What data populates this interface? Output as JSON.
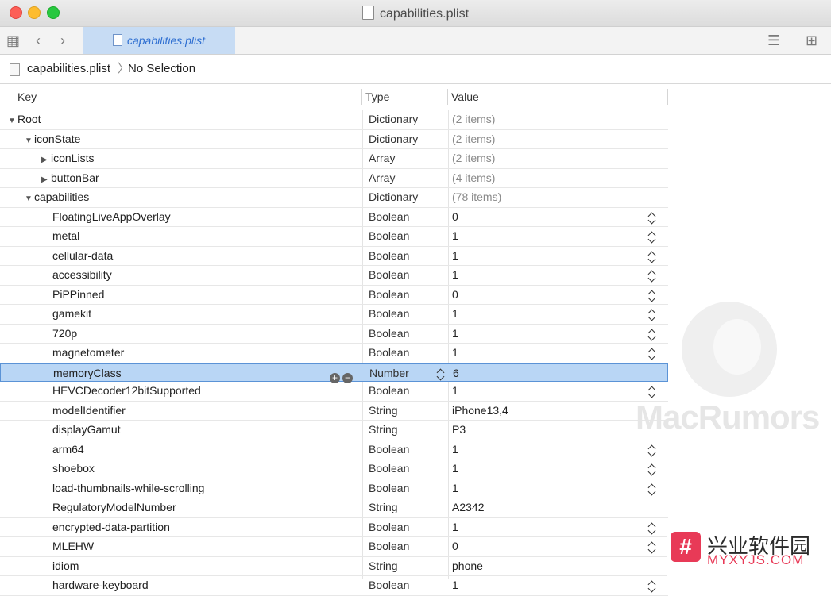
{
  "window": {
    "title": "capabilities.plist"
  },
  "toolbar": {
    "tab_label": "capabilities.plist"
  },
  "jumpbar": {
    "file": "capabilities.plist",
    "separator": "〉",
    "selection": "No Selection"
  },
  "columns": {
    "key": "Key",
    "type": "Type",
    "value": "Value"
  },
  "rows": [
    {
      "key": "Root",
      "type": "Dictionary",
      "value": "(2 items)"
    },
    {
      "key": "iconState",
      "type": "Dictionary",
      "value": "(2 items)"
    },
    {
      "key": "iconLists",
      "type": "Array",
      "value": "(2 items)"
    },
    {
      "key": "buttonBar",
      "type": "Array",
      "value": "(4 items)"
    },
    {
      "key": "capabilities",
      "type": "Dictionary",
      "value": "(78 items)"
    },
    {
      "key": "FloatingLiveAppOverlay",
      "type": "Boolean",
      "value": "0"
    },
    {
      "key": "metal",
      "type": "Boolean",
      "value": "1"
    },
    {
      "key": "cellular-data",
      "type": "Boolean",
      "value": "1"
    },
    {
      "key": "accessibility",
      "type": "Boolean",
      "value": "1"
    },
    {
      "key": "PiPPinned",
      "type": "Boolean",
      "value": "0"
    },
    {
      "key": "gamekit",
      "type": "Boolean",
      "value": "1"
    },
    {
      "key": "720p",
      "type": "Boolean",
      "value": "1"
    },
    {
      "key": "magnetometer",
      "type": "Boolean",
      "value": "1"
    },
    {
      "key": "memoryClass",
      "type": "Number",
      "value": "6"
    },
    {
      "key": "HEVCDecoder12bitSupported",
      "type": "Boolean",
      "value": "1"
    },
    {
      "key": "modelIdentifier",
      "type": "String",
      "value": "iPhone13,4"
    },
    {
      "key": "displayGamut",
      "type": "String",
      "value": "P3"
    },
    {
      "key": "arm64",
      "type": "Boolean",
      "value": "1"
    },
    {
      "key": "shoebox",
      "type": "Boolean",
      "value": "1"
    },
    {
      "key": "load-thumbnails-while-scrolling",
      "type": "Boolean",
      "value": "1"
    },
    {
      "key": "RegulatoryModelNumber",
      "type": "String",
      "value": "A2342"
    },
    {
      "key": "encrypted-data-partition",
      "type": "Boolean",
      "value": "1"
    },
    {
      "key": "MLEHW",
      "type": "Boolean",
      "value": "0"
    },
    {
      "key": "idiom",
      "type": "String",
      "value": "phone"
    },
    {
      "key": "hardware-keyboard",
      "type": "Boolean",
      "value": "1"
    }
  ],
  "watermark": {
    "text": "MacRumors"
  },
  "logo": {
    "mark": "#",
    "cn": "兴业软件园",
    "en": "MYXYJS.COM"
  },
  "icons": {
    "grid": "grid-icon",
    "back": "chevron-left-icon",
    "forward": "chevron-right-icon",
    "list": "lines-icon",
    "split": "split-view-icon"
  }
}
